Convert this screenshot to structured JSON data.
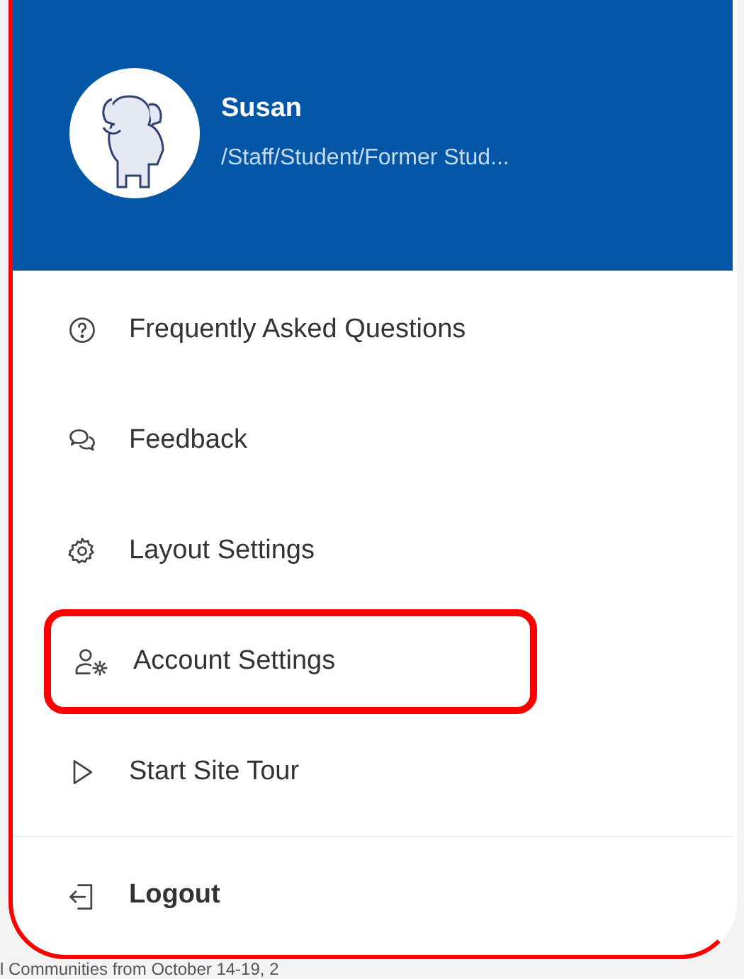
{
  "profile": {
    "name": "Susan",
    "roles": "/Staff/Student/Former Stud..."
  },
  "menu_items": [
    {
      "label": "Frequently Asked Questions",
      "kind": "faq",
      "highlighted": false
    },
    {
      "label": "Feedback",
      "kind": "feedback",
      "highlighted": false
    },
    {
      "label": "Layout Settings",
      "kind": "layout",
      "highlighted": false
    },
    {
      "label": "Account Settings",
      "kind": "account",
      "highlighted": true
    },
    {
      "label": "Start Site Tour",
      "kind": "tour",
      "highlighted": false
    }
  ],
  "logout": {
    "label": "Logout"
  },
  "background_text": "l Communities from October 14-19, 2"
}
